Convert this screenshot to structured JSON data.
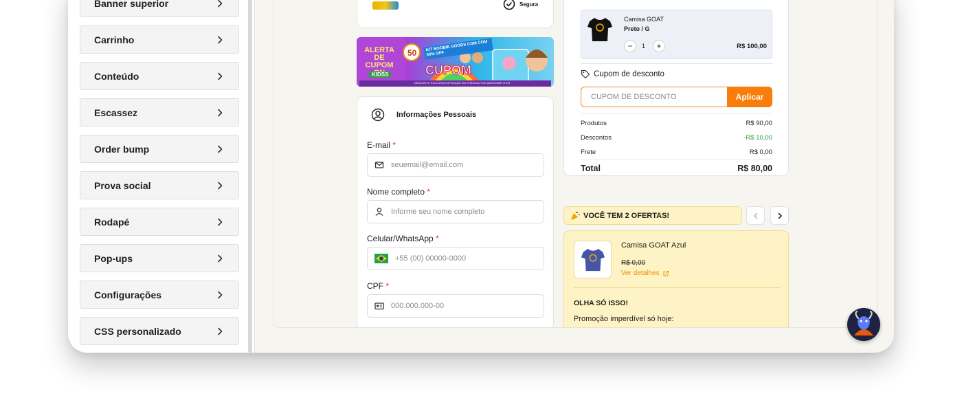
{
  "sidebar": {
    "items": [
      {
        "label": "Banner superior"
      },
      {
        "label": "Carrinho"
      },
      {
        "label": "Conteúdo"
      },
      {
        "label": "Escassez"
      },
      {
        "label": "Order bump"
      },
      {
        "label": "Prova social"
      },
      {
        "label": "Rodapé"
      },
      {
        "label": "Pop-ups"
      },
      {
        "label": "Configurações"
      },
      {
        "label": "CSS personalizado"
      }
    ]
  },
  "seal": {
    "label": "Segura"
  },
  "banner": {
    "left_text": "ALERTA DE CUPOM ON",
    "kids": "KIDSS",
    "badge": "50",
    "ribbon": "KIT BOOBIE GOODS COM COM 50% OFF",
    "cupom": "CUPOM",
    "footer": "DESCONTO EXCLUSIVO APLICADO NO CHECKOUT AO ADICIONAR O KIT"
  },
  "personal": {
    "title": "Informações Pessoais",
    "email_label": "E-mail",
    "email_placeholder": "seuemail@email.com",
    "name_label": "Nome completo",
    "name_placeholder": "Informe seu nome completo",
    "phone_label": "Celular/WhatsApp",
    "phone_placeholder": "+55 (00) 00000-0000",
    "cpf_label": "CPF",
    "cpf_placeholder": "000.000.000-00",
    "required_mark": "*"
  },
  "cart": {
    "product_name": "Camisa GOAT",
    "variant": "Preto / G",
    "quantity": "1",
    "price": "R$ 100,00",
    "minus": "−",
    "plus": "+"
  },
  "coupon": {
    "title": "Cupom de desconto",
    "placeholder": "CUPOM DE DESCONTO",
    "apply_label": "Aplicar"
  },
  "summary": {
    "products_label": "Produtos",
    "products_value": "R$ 90,00",
    "discounts_label": "Descontos",
    "discounts_value": "-R$ 10,00",
    "shipping_label": "Frete",
    "shipping_value": "R$ 0,00",
    "total_label": "Total",
    "total_value": "R$ 80,00"
  },
  "offers": {
    "bar_text": "VOCÊ TEM 2 OFERTAS!",
    "item_name": "Camisa GOAT Azul",
    "old_price": "R$ 0,00",
    "details_link": "Ver detalhes",
    "headline": "OLHA SÓ ISSO!",
    "description": "Promoção imperdível só hoje:"
  },
  "colors": {
    "accent": "#f97d0b",
    "discount_green": "#2f9e44",
    "offer_bg": "#fdf3c4"
  }
}
